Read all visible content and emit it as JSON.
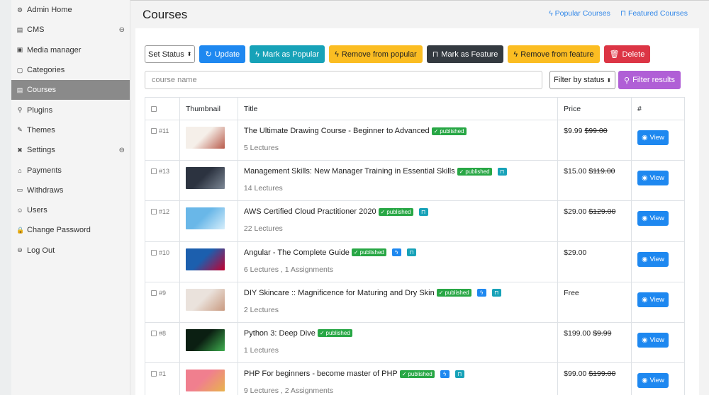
{
  "sidebar": {
    "items": [
      {
        "icon": "⚙",
        "label": "Admin Home",
        "name": "sidebar-item-admin-home",
        "iconname": "dashboard-icon"
      },
      {
        "icon": "▤",
        "label": "CMS",
        "name": "sidebar-item-cms",
        "iconname": "cms-icon",
        "toggle": "⊖"
      },
      {
        "icon": "▣",
        "label": "Media manager",
        "name": "sidebar-item-media-manager",
        "iconname": "media-icon"
      },
      {
        "icon": "▢",
        "label": "Categories",
        "name": "sidebar-item-categories",
        "iconname": "categories-icon"
      },
      {
        "icon": "▤",
        "label": "Courses",
        "name": "sidebar-item-courses",
        "iconname": "courses-icon",
        "active": true
      },
      {
        "icon": "⚲",
        "label": "Plugins",
        "name": "sidebar-item-plugins",
        "iconname": "plug-icon"
      },
      {
        "icon": "✎",
        "label": "Themes",
        "name": "sidebar-item-themes",
        "iconname": "brush-icon"
      },
      {
        "icon": "✖",
        "label": "Settings",
        "name": "sidebar-item-settings",
        "iconname": "tools-icon",
        "toggle": "⊖"
      },
      {
        "icon": "⌂",
        "label": "Payments",
        "name": "sidebar-item-payments",
        "iconname": "payments-icon"
      },
      {
        "icon": "▭",
        "label": "Withdraws",
        "name": "sidebar-item-withdraws",
        "iconname": "wallet-icon"
      },
      {
        "icon": "☺",
        "label": "Users",
        "name": "sidebar-item-users",
        "iconname": "users-icon"
      },
      {
        "icon": "🔒",
        "label": "Change Password",
        "name": "sidebar-item-change-password",
        "iconname": "lock-icon"
      },
      {
        "icon": "⊖",
        "label": "Log Out",
        "name": "sidebar-item-log-out",
        "iconname": "logout-icon"
      }
    ]
  },
  "header": {
    "title": "Courses",
    "links": {
      "popular": "Popular Courses",
      "featured": "Featured Courses",
      "popular_icon": "ϟ",
      "featured_icon": "⊓"
    }
  },
  "toolbar": {
    "set_status": "Set Status",
    "update": "Update",
    "mark_popular": "Mark as Popular",
    "remove_popular": "Remove from popular",
    "mark_feature": "Mark as Feature",
    "remove_feature": "Remove from feature",
    "delete": "Delete"
  },
  "search": {
    "placeholder": "course name",
    "filter_status": "Filter by status",
    "filter_button": "Filter results"
  },
  "table": {
    "columns": {
      "thumbnail": "Thumbnail",
      "title": "Title",
      "price": "Price",
      "action": "#"
    },
    "view_label": "View",
    "published_label": "published",
    "rows": [
      {
        "id": "#11",
        "title": "The Ultimate Drawing Course - Beginner to Advanced",
        "popular": false,
        "featured": false,
        "meta": "5 Lectures",
        "price": "$9.99",
        "old_price": "$99.00",
        "thumb_colors": [
          "#f5efe9",
          "#b85a4a"
        ]
      },
      {
        "id": "#13",
        "title": "Management Skills: New Manager Training in Essential Skills",
        "popular": false,
        "featured": true,
        "meta": "14 Lectures",
        "price": "$15.00",
        "old_price": "$119.00",
        "thumb_colors": [
          "#2c3340",
          "#7d8896"
        ]
      },
      {
        "id": "#12",
        "title": "AWS Certified Cloud Practitioner 2020",
        "popular": false,
        "featured": true,
        "meta": "22 Lectures",
        "price": "$29.00",
        "old_price": "$129.00",
        "thumb_colors": [
          "#69b7e8",
          "#d6eefb"
        ]
      },
      {
        "id": "#10",
        "title": "Angular - The Complete Guide",
        "popular": true,
        "featured": true,
        "meta": "6 Lectures , 1 Assignments",
        "price": "$29.00",
        "old_price": "",
        "thumb_colors": [
          "#1c5fae",
          "#c3002f"
        ]
      },
      {
        "id": "#9",
        "title": "DIY Skincare :: Magnificence for Maturing and Dry Skin",
        "popular": true,
        "featured": true,
        "meta": "2 Lectures",
        "price": "Free",
        "old_price": "",
        "thumb_colors": [
          "#eae2dc",
          "#c99a80"
        ]
      },
      {
        "id": "#8",
        "title": "Python 3: Deep Dive",
        "popular": false,
        "featured": false,
        "meta": "1 Lectures",
        "price": "$199.00",
        "old_price": "$9.99",
        "thumb_colors": [
          "#0b1f12",
          "#3fae4f"
        ]
      },
      {
        "id": "#1",
        "title": "PHP For beginners - become master of PHP",
        "popular": true,
        "featured": true,
        "meta": "9 Lectures , 2 Assignments",
        "price": "$99.00",
        "old_price": "$199.00",
        "thumb_colors": [
          "#f07f8e",
          "#e8b34c"
        ]
      }
    ]
  }
}
